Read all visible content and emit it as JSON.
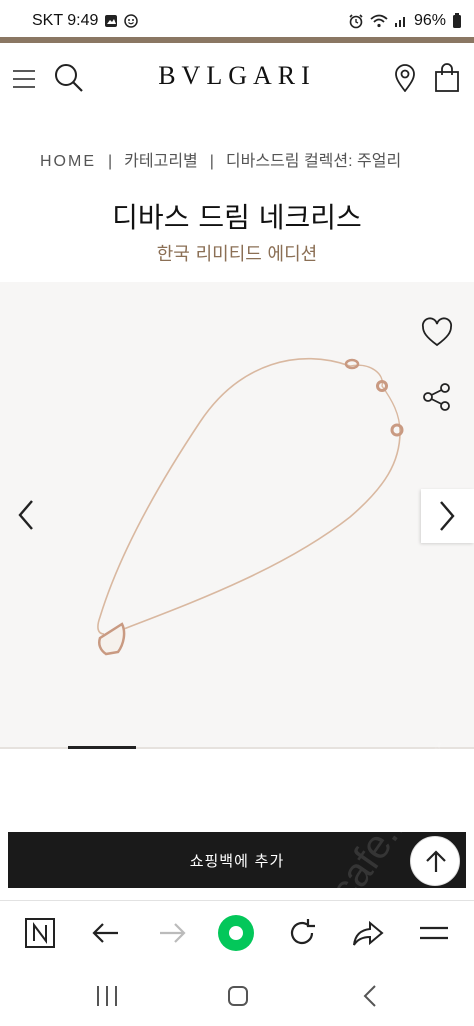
{
  "status_bar": {
    "carrier_time": "SKT 9:49",
    "battery": "96%"
  },
  "header": {
    "logo": "BVLGARI"
  },
  "breadcrumb": {
    "home": "HOME",
    "separator": "|",
    "category": "카테고리별",
    "collection": "디바스드림 컬렉션: 주얼리"
  },
  "product": {
    "title": "디바스 드림 네크리스",
    "subtitle": "한국 리미티드 에디션"
  },
  "gallery": {
    "current_slide": 2
  },
  "cta": {
    "add_to_bag": "쇼핑백에 추가"
  },
  "watermark": "cafe.naver",
  "colors": {
    "accent_brown": "#8a7763",
    "subtitle_brown": "#8b6f55",
    "cta_black": "#1a1a1a",
    "browser_green": "#03c75a"
  },
  "icons": {
    "menu": "hamburger-icon",
    "search": "search-icon",
    "store": "location-pin-icon",
    "bag": "shopping-bag-icon",
    "wishlist": "heart-icon",
    "share": "share-icon",
    "prev": "chevron-left-icon",
    "next": "chevron-right-icon",
    "scroll_top": "arrow-up-icon",
    "browser_home": "naver-n-icon",
    "back": "arrow-left-icon",
    "forward": "arrow-right-icon",
    "green_dot": "green-dot-icon",
    "reload": "reload-icon",
    "browser_share": "forward-share-icon",
    "browser_menu": "menu-lines-icon",
    "recents": "recents-icon",
    "home": "home-circle-icon",
    "system_back": "system-back-icon"
  }
}
